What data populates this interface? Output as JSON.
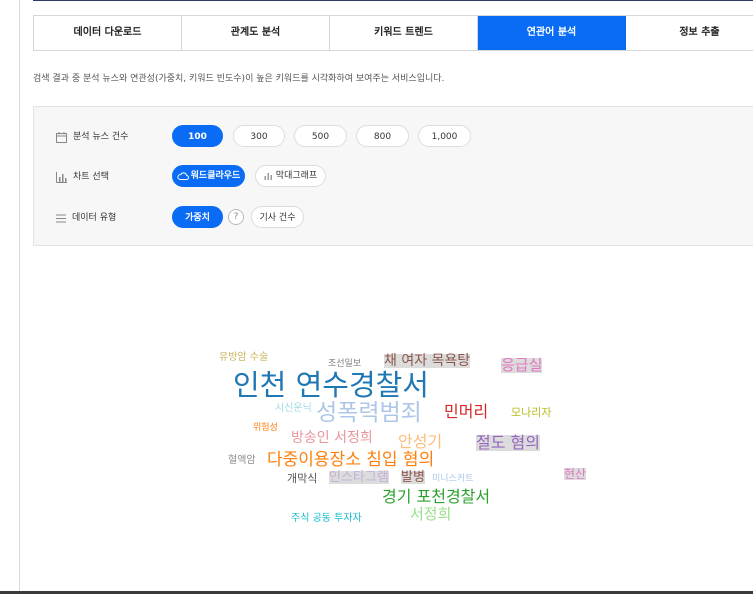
{
  "tabs": [
    {
      "label": "데이터 다운로드"
    },
    {
      "label": "관계도 분석"
    },
    {
      "label": "키워드 트렌드"
    },
    {
      "label": "연관어 분석"
    },
    {
      "label": "정보 추출"
    }
  ],
  "active_tab": "연관어 분석",
  "description": "검색 결과 중 분석 뉴스와 연관성(가중치, 키워드 빈도수)이 높은 키워드를 시각화하여 보여주는 서비스입니다.",
  "filters": {
    "news_count": {
      "label": "분석 뉴스 건수",
      "options": [
        "100",
        "300",
        "500",
        "800",
        "1,000"
      ],
      "selected": "100"
    },
    "chart_type": {
      "label": "차트 선택",
      "options": [
        "워드클라우드",
        "막대그래프"
      ],
      "selected": "워드클라우드"
    },
    "data_type": {
      "label": "데이터 유형",
      "options": [
        "가중치",
        "기사 건수"
      ],
      "selected": "가중치",
      "help": "?"
    }
  },
  "word_cloud": [
    {
      "text": "유방암 수술",
      "color": "#c9b45a"
    },
    {
      "text": "조선일보",
      "color": "#7f7f7f"
    },
    {
      "text": "채 여자 목욕탕",
      "color": "#8c564b",
      "highlight": true
    },
    {
      "text": "응급실",
      "color": "#e377c2",
      "highlight": true
    },
    {
      "text": "인천 연수경찰서",
      "color": "#1f77b4"
    },
    {
      "text": "시신운닉",
      "color": "#9edae5"
    },
    {
      "text": "성폭력범죄",
      "color": "#aec7e8"
    },
    {
      "text": "민머리",
      "color": "#d62728"
    },
    {
      "text": "모나리자",
      "color": "#bcbd22"
    },
    {
      "text": "위험성",
      "color": "#ff7f0e"
    },
    {
      "text": "방송인 서정희",
      "color": "#e7969c"
    },
    {
      "text": "안성기",
      "color": "#ffbb78"
    },
    {
      "text": "절도 혐의",
      "color": "#9467bd",
      "highlight": true
    },
    {
      "text": "혈액암",
      "color": "#8c8c8c"
    },
    {
      "text": "다중이용장소 침입 혐의",
      "color": "#ff7f0e"
    },
    {
      "text": "개막식",
      "color": "#555555"
    },
    {
      "text": "인스타그램",
      "color": "#c5b0d5",
      "highlight": true
    },
    {
      "text": "발병",
      "color": "#8c564b",
      "highlight": true
    },
    {
      "text": "미니스커트",
      "color": "#aec7e8"
    },
    {
      "text": "현산",
      "color": "#e377c2",
      "highlight": true
    },
    {
      "text": "경기 포천경찰서",
      "color": "#2ca02c"
    },
    {
      "text": "서정희",
      "color": "#98df8a"
    },
    {
      "text": "주식 공동 투자자",
      "color": "#17becf"
    }
  ]
}
